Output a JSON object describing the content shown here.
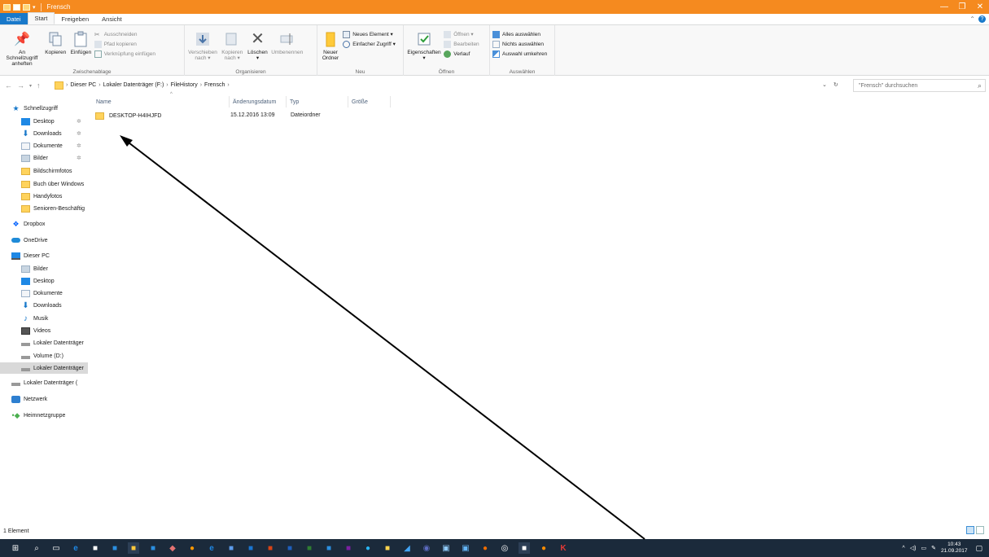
{
  "window": {
    "title": "Frensch",
    "controls": {
      "minimize": "—",
      "maximize": "❐",
      "close": "✕"
    }
  },
  "ribbon": {
    "tabs": [
      "Datei",
      "Start",
      "Freigeben",
      "Ansicht"
    ],
    "groups": {
      "clipboard": {
        "label": "Zwischenablage",
        "pin": "An Schnellzugriff anheften",
        "copy": "Kopieren",
        "paste": "Einfügen",
        "cut": "Ausschneiden",
        "copy_path": "Pfad kopieren",
        "paste_shortcut": "Verknüpfung einfügen"
      },
      "organize": {
        "label": "Organisieren",
        "move_to": "Verschieben nach ▾",
        "copy_to": "Kopieren nach ▾",
        "delete": "Löschen ▾",
        "rename": "Umbenennen"
      },
      "new": {
        "label": "Neu",
        "new_folder": "Neuer Ordner",
        "new_item": "Neues Element ▾",
        "easy_access": "Einfacher Zugriff ▾"
      },
      "open": {
        "label": "Öffnen",
        "properties": "Eigenschaften ▾",
        "open": "Öffnen ▾",
        "edit": "Bearbeiten",
        "history": "Verlauf"
      },
      "select": {
        "label": "Auswählen",
        "select_all": "Alles auswählen",
        "select_none": "Nichts auswählen",
        "invert": "Auswahl umkehren"
      }
    }
  },
  "address": {
    "crumbs": [
      "Dieser PC",
      "Lokaler Datenträger (F:)",
      "FileHistory",
      "Frensch"
    ],
    "search_placeholder": "\"Frensch\" durchsuchen"
  },
  "nav_pane": {
    "items": [
      {
        "label": "Schnellzugriff",
        "icon": "star-icon"
      },
      {
        "label": "Desktop",
        "icon": "desktop-icon",
        "pinned": true
      },
      {
        "label": "Downloads",
        "icon": "download-icon",
        "pinned": true
      },
      {
        "label": "Dokumente",
        "icon": "documents-icon",
        "pinned": true
      },
      {
        "label": "Bilder",
        "icon": "pictures-icon",
        "pinned": true
      },
      {
        "label": "Bildschirmfotos",
        "icon": "folder-icon"
      },
      {
        "label": "Buch über Windows",
        "icon": "folder-icon"
      },
      {
        "label": "Handyfotos",
        "icon": "folder-icon"
      },
      {
        "label": "Senioren-Beschäftig",
        "icon": "folder-icon"
      },
      {
        "label": "Dropbox",
        "icon": "dropbox-icon"
      },
      {
        "label": "OneDrive",
        "icon": "onedrive-icon"
      },
      {
        "label": "Dieser PC",
        "icon": "pc-icon"
      },
      {
        "label": "Bilder",
        "icon": "pictures-icon"
      },
      {
        "label": "Desktop",
        "icon": "desktop-icon"
      },
      {
        "label": "Dokumente",
        "icon": "documents-icon"
      },
      {
        "label": "Downloads",
        "icon": "download-icon"
      },
      {
        "label": "Musik",
        "icon": "music-icon"
      },
      {
        "label": "Videos",
        "icon": "video-icon"
      },
      {
        "label": "Lokaler Datenträger",
        "icon": "drive-icon"
      },
      {
        "label": "Volume (D:)",
        "icon": "drive-icon"
      },
      {
        "label": "Lokaler Datenträger",
        "icon": "drive-icon",
        "selected": true
      },
      {
        "label": "Lokaler Datenträger (",
        "icon": "drive-icon"
      },
      {
        "label": "Netzwerk",
        "icon": "network-icon"
      },
      {
        "label": "Heimnetzgruppe",
        "icon": "homegroup-icon"
      }
    ]
  },
  "file_list": {
    "columns": [
      "Name",
      "Änderungsdatum",
      "Typ",
      "Größe"
    ],
    "rows": [
      {
        "name": "DESKTOP-H4IHJFD",
        "modified": "15.12.2016 13:09",
        "type": "Dateiordner",
        "size": ""
      }
    ]
  },
  "status_bar": {
    "count": "1 Element"
  },
  "taskbar": {
    "time": "10:43",
    "date": "21.09.2017"
  },
  "colors": {
    "titlebar": "#f58a1f",
    "file_tab": "#1979ca",
    "taskbar": "#1b2a3b",
    "annotation_arrow": "#000000"
  }
}
